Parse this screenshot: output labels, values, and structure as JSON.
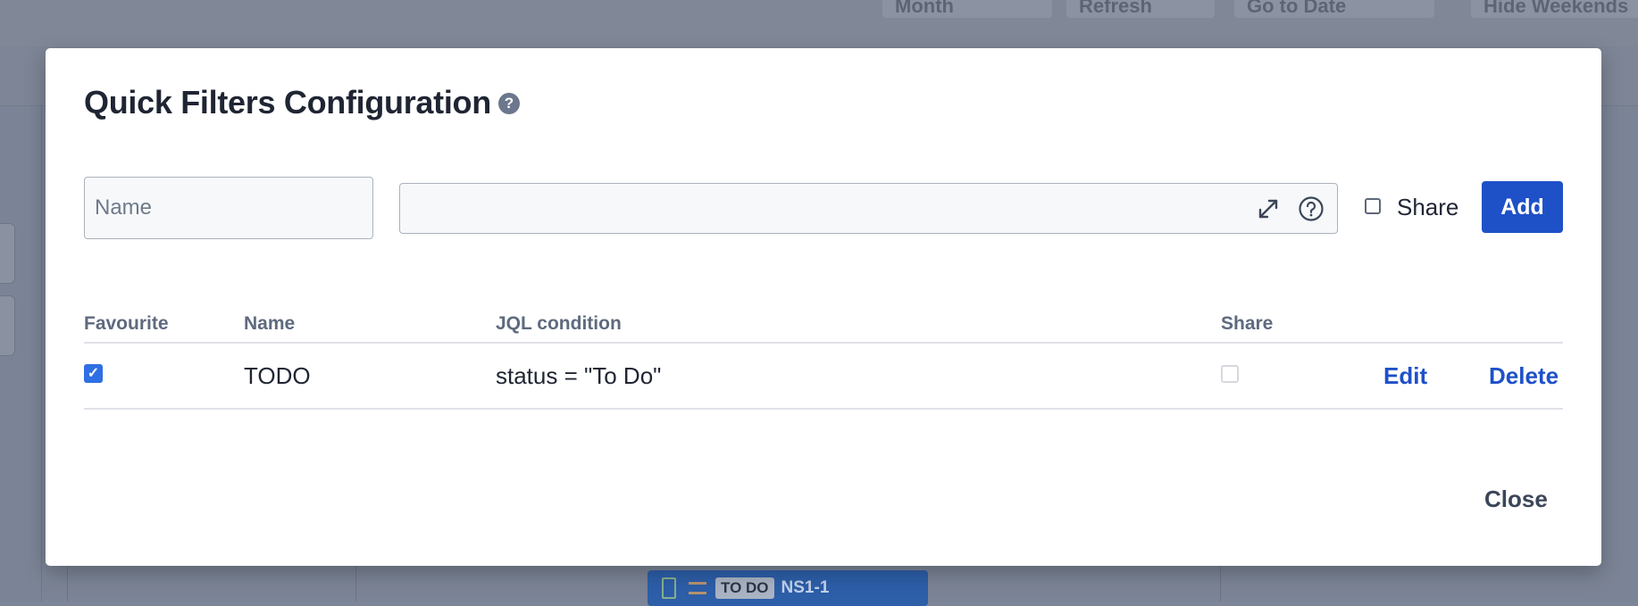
{
  "background": {
    "toolbar": [
      "Month",
      "Refresh",
      "Go to Date",
      "Hide Weekends"
    ],
    "card": {
      "status": "TO DO",
      "key": "NS1-1"
    }
  },
  "modal": {
    "title": "Quick Filters Configuration",
    "help_glyph": "?",
    "form": {
      "name_placeholder": "Name",
      "jql_value": "",
      "share_label": "Share",
      "share_checked": false,
      "add_label": "Add"
    },
    "table": {
      "headers": {
        "favourite": "Favourite",
        "name": "Name",
        "jql": "JQL condition",
        "share": "Share"
      },
      "rows": [
        {
          "favourite": true,
          "name": "TODO",
          "jql": "status = \"To Do\"",
          "share": false,
          "edit_label": "Edit",
          "delete_label": "Delete"
        }
      ]
    },
    "close_label": "Close"
  },
  "colors": {
    "primary": "#1e50c8",
    "overlay": "#7d8699",
    "text": "#1f2533",
    "header_text": "#5e6a7e"
  },
  "icons": [
    "help-icon",
    "expand-icon",
    "jql-help-icon",
    "checkbox-checked-icon",
    "checkbox-empty-icon"
  ]
}
